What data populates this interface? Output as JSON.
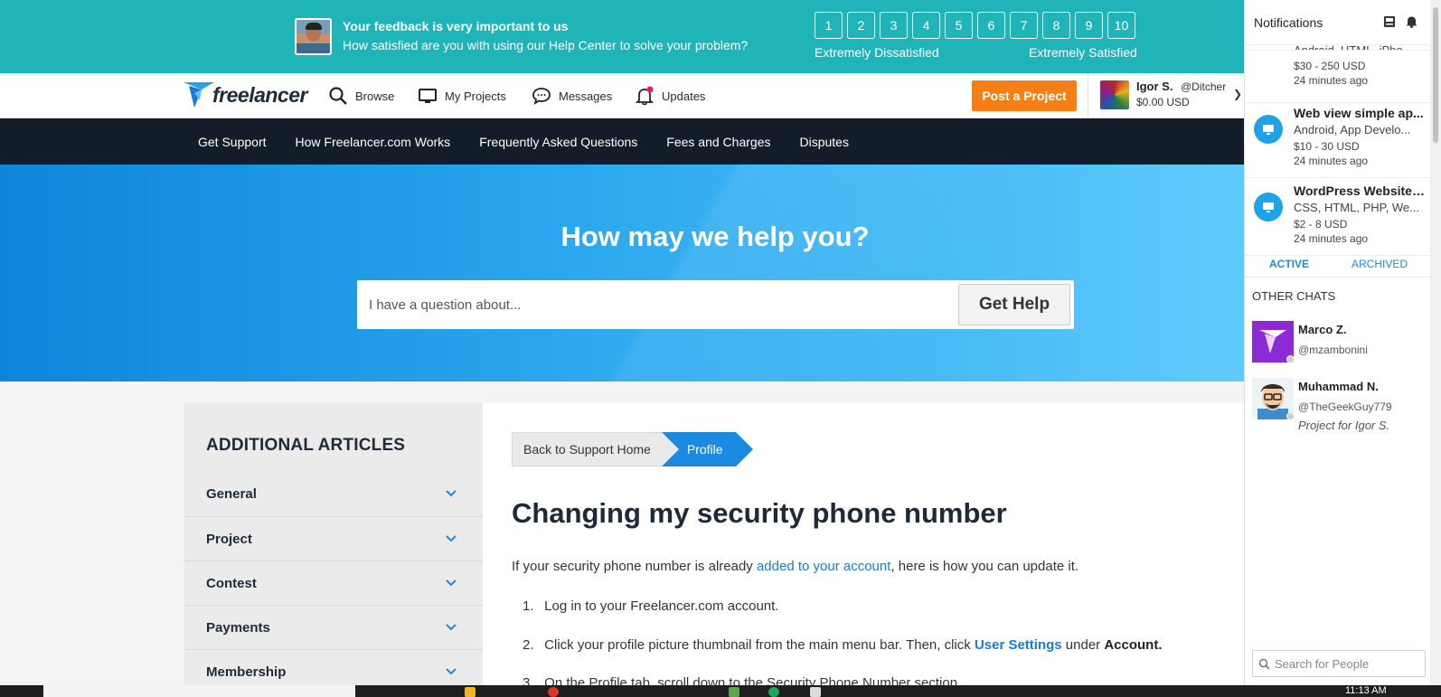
{
  "feedback": {
    "title": "Your feedback is very important to us",
    "subtitle": "How satisfied are you with using our Help Center to solve your problem?",
    "scale": [
      "1",
      "2",
      "3",
      "4",
      "5",
      "6",
      "7",
      "8",
      "9",
      "10"
    ],
    "low_label": "Extremely Dissatisfied",
    "high_label": "Extremely Satisfied"
  },
  "nav": {
    "logo_text": "freelancer",
    "items": [
      {
        "label": "Browse",
        "icon": "search-icon"
      },
      {
        "label": "My Projects",
        "icon": "monitor-icon"
      },
      {
        "label": "Messages",
        "icon": "chat-bubble-icon"
      },
      {
        "label": "Updates",
        "icon": "bell-icon"
      }
    ],
    "post_label": "Post a Project",
    "user": {
      "name": "Igor S.",
      "handle": "@Ditcher",
      "balance": "$0.00 USD"
    }
  },
  "subnav": [
    "Get Support",
    "How Freelancer.com Works",
    "Frequently Asked Questions",
    "Fees and Charges",
    "Disputes"
  ],
  "hero": {
    "title": "How may we help you?",
    "placeholder": "I have a question about...",
    "button": "Get Help"
  },
  "sidebar": {
    "heading": "ADDITIONAL ARTICLES",
    "items": [
      "General",
      "Project",
      "Contest",
      "Payments",
      "Membership"
    ]
  },
  "article": {
    "breadcrumb_back": "Back to Support Home",
    "breadcrumb_current": "Profile",
    "title": "Changing my security phone number",
    "intro_pre": "If your security phone number is already ",
    "intro_link": "added to your account",
    "intro_post": ", here is how you can update it.",
    "steps": [
      {
        "num": "1.",
        "text": "Log in to your Freelancer.com account."
      },
      {
        "num": "2.",
        "pre": "Click your profile picture thumbnail from the main menu bar. Then, click ",
        "link": "User Settings",
        "mid": " under ",
        "bold": "Account."
      },
      {
        "num": "3.",
        "text": "On the Profile tab, scroll down to the Security Phone Number section."
      }
    ]
  },
  "panel": {
    "title": "Notifications",
    "notifications": [
      {
        "title": "",
        "skills": "Android, HTML, iPho...",
        "budget": "$30 - 250 USD",
        "age": "24 minutes ago"
      },
      {
        "title": "Web view simple ap...",
        "skills": "Android, App Develo...",
        "budget": "$10 - 30 USD",
        "age": "24 minutes ago"
      },
      {
        "title": "WordPress Website ...",
        "skills": "CSS, HTML, PHP, We...",
        "budget": "$2 - 8 USD",
        "age": "24 minutes ago"
      }
    ],
    "tab_active": "ACTIVE",
    "tab_archived": "ARCHIVED",
    "other_chats": "OTHER CHATS",
    "chats": [
      {
        "name": "Marco Z.",
        "handle": "@mzambonini",
        "project": ""
      },
      {
        "name": "Muhammad N.",
        "handle": "@TheGeekGuy779",
        "project": "Project for Igor S."
      }
    ],
    "search_placeholder": "Search for People"
  },
  "taskbar": {
    "clock": "11:13 AM"
  },
  "colors": {
    "teal": "#1fb5b8",
    "brand_blue": "#1b8ae1",
    "orange": "#f77e13",
    "dark_nav": "#131c29"
  }
}
